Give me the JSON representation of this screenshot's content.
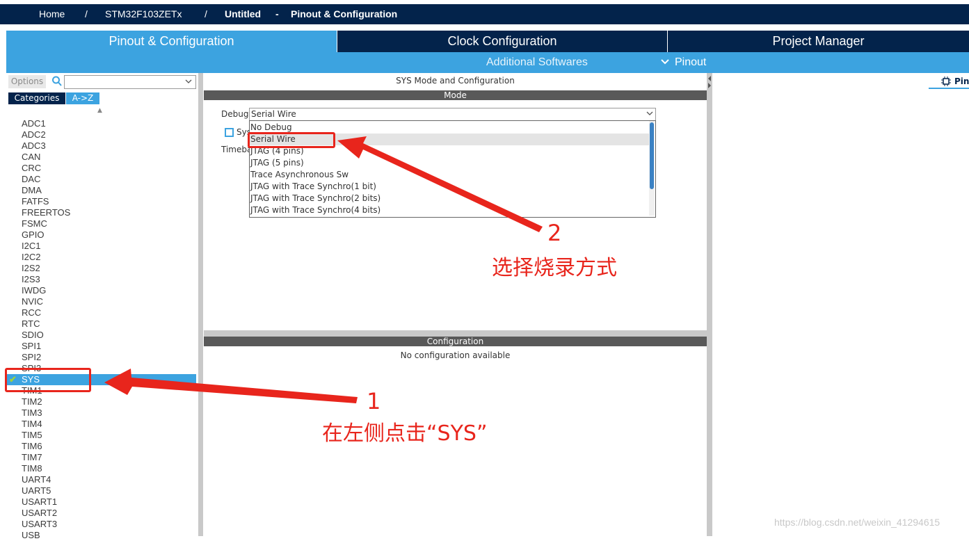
{
  "breadcrumb": {
    "home": "Home",
    "sep1": "/",
    "chip": "STM32F103ZETx",
    "sep2": "/",
    "project": "Untitled",
    "dash": "-",
    "page": "Pinout & Configuration"
  },
  "tabs": [
    {
      "label": "Pinout & Configuration",
      "active": true
    },
    {
      "label": "Clock Configuration",
      "active": false
    },
    {
      "label": "Project Manager",
      "active": false
    }
  ],
  "subtabs": {
    "additional": "Additional Softwares",
    "pinout": "Pinout"
  },
  "left": {
    "options_label": "Options",
    "categories_label": "Categories",
    "az_label": "A->Z",
    "sort_glyph": "▲",
    "items": [
      "ADC1",
      "ADC2",
      "ADC3",
      "CAN",
      "CRC",
      "DAC",
      "DMA",
      "FATFS",
      "FREERTOS",
      "FSMC",
      "GPIO",
      "I2C1",
      "I2C2",
      "I2S2",
      "I2S3",
      "IWDG",
      "NVIC",
      "RCC",
      "RTC",
      "SDIO",
      "SPI1",
      "SPI2",
      "SPI3",
      "SYS",
      "TIM1",
      "TIM2",
      "TIM3",
      "TIM4",
      "TIM5",
      "TIM6",
      "TIM7",
      "TIM8",
      "UART4",
      "UART5",
      "USART1",
      "USART2",
      "USART3",
      "USB"
    ],
    "selected": "SYS",
    "check_glyph": "✔"
  },
  "middle": {
    "title": "SYS Mode and Configuration",
    "mode_header": "Mode",
    "debug_label": "Debug",
    "debug_value": "Serial Wire",
    "sys_label": "Sys",
    "timebase_label": "Timeba",
    "dropdown_options": [
      "No Debug",
      "Serial Wire",
      "JTAG (4 pins)",
      "JTAG (5 pins)",
      "Trace Asynchronous Sw",
      "JTAG with Trace Synchro(1 bit)",
      "JTAG with Trace Synchro(2 bits)",
      "JTAG with Trace Synchro(4 bits)"
    ],
    "highlighted_option": "Serial Wire",
    "config_header": "Configuration",
    "no_config": "No configuration available"
  },
  "right": {
    "pinout_view_label": "Pin"
  },
  "annotations": {
    "step1_number": "1",
    "step1_text": "在左侧点击“SYS”",
    "step2_number": "2",
    "step2_text": "选择烧录方式"
  },
  "watermark": "https://blog.csdn.net/weixin_41294615",
  "colors": {
    "navy": "#03234b",
    "accent": "#3ca3e0",
    "annotation_red": "#e8251c"
  }
}
